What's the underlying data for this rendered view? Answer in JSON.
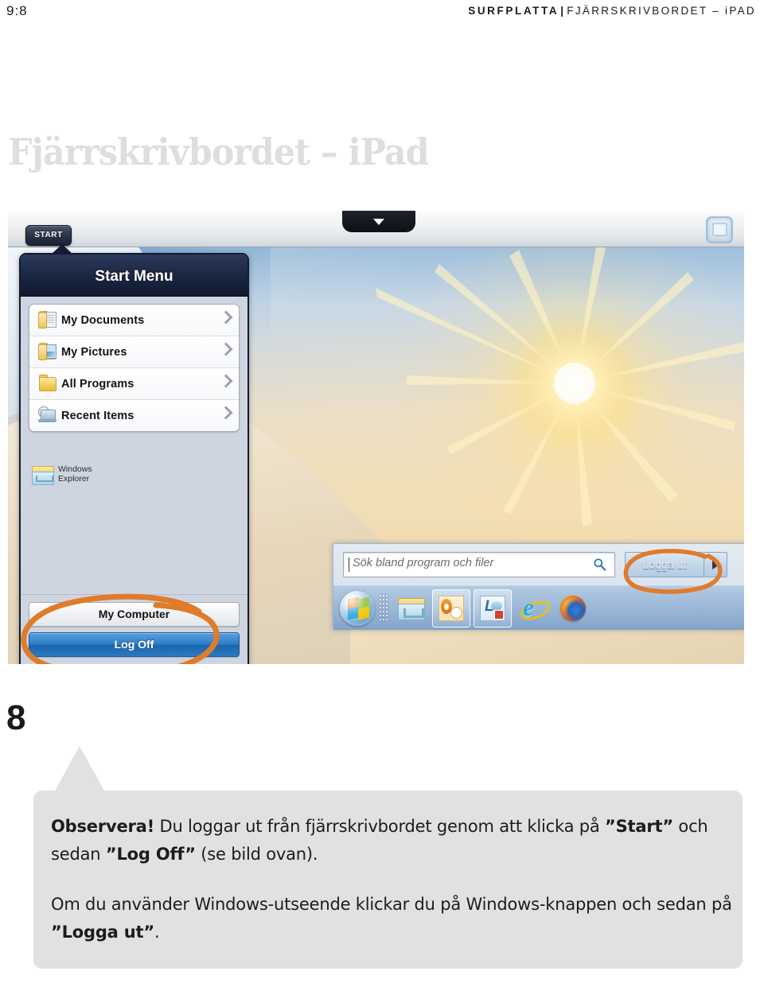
{
  "running_head": {
    "folio": "9:8",
    "crumb_bold": "SURFPLATTA",
    "crumb_separator": "|",
    "crumb_rest": "FJÄRRSKRIVBORDET – iPAD"
  },
  "page_title": "Fjärrskrivbordet – iPad",
  "figure": {
    "toolbar": {
      "dropdown_handle": "chevron-down",
      "right_icon": "screen-toggle"
    },
    "start_button": "START",
    "start_menu": {
      "title": "Start Menu",
      "items": [
        {
          "label": "My Documents",
          "icon": "folder-document-icon"
        },
        {
          "label": "My Pictures",
          "icon": "folder-picture-icon"
        },
        {
          "label": "All Programs",
          "icon": "folder-icon"
        },
        {
          "label": "Recent Items",
          "icon": "recent-items-icon"
        }
      ],
      "shortcut": {
        "line1": "Windows",
        "line2": "Explorer",
        "icon": "windows-explorer-icon"
      },
      "footer_buttons": [
        {
          "label": "My Computer",
          "style": "white"
        },
        {
          "label": "Log Off",
          "style": "blue"
        }
      ]
    },
    "windows_panel": {
      "search_placeholder": "Sök bland program och filer",
      "search_value": "",
      "search_icon": "magnifier-icon",
      "logout_label": "Logga ut",
      "logout_arrow_icon": "play-arrow-icon",
      "taskbar": [
        {
          "name": "windows-orb-icon"
        },
        {
          "name": "taskbar-grip"
        },
        {
          "name": "windows-explorer-icon"
        },
        {
          "name": "outlook-icon"
        },
        {
          "name": "lync-icon"
        },
        {
          "name": "internet-explorer-icon"
        },
        {
          "name": "firefox-icon"
        }
      ]
    },
    "annotations": {
      "color": "#e07b2a",
      "shapes": [
        "ellipse-around-my-computer-and-log-off",
        "ellipse-around-logga-ut"
      ]
    }
  },
  "step_number": "8",
  "callout": {
    "p1_lead": "Observera!",
    "p1_a": " Du loggar ut från fjärrskrivbordet genom att klicka på ",
    "p1_b": "”Start”",
    "p1_c": " och sedan ",
    "p1_d": "”Log Off”",
    "p1_e": " (se bild ovan).",
    "p2_a": "Om du använder Windows-utseende klickar du på Windows-knappen och sedan på ",
    "p2_b": "”Logga ut”",
    "p2_c": "."
  }
}
